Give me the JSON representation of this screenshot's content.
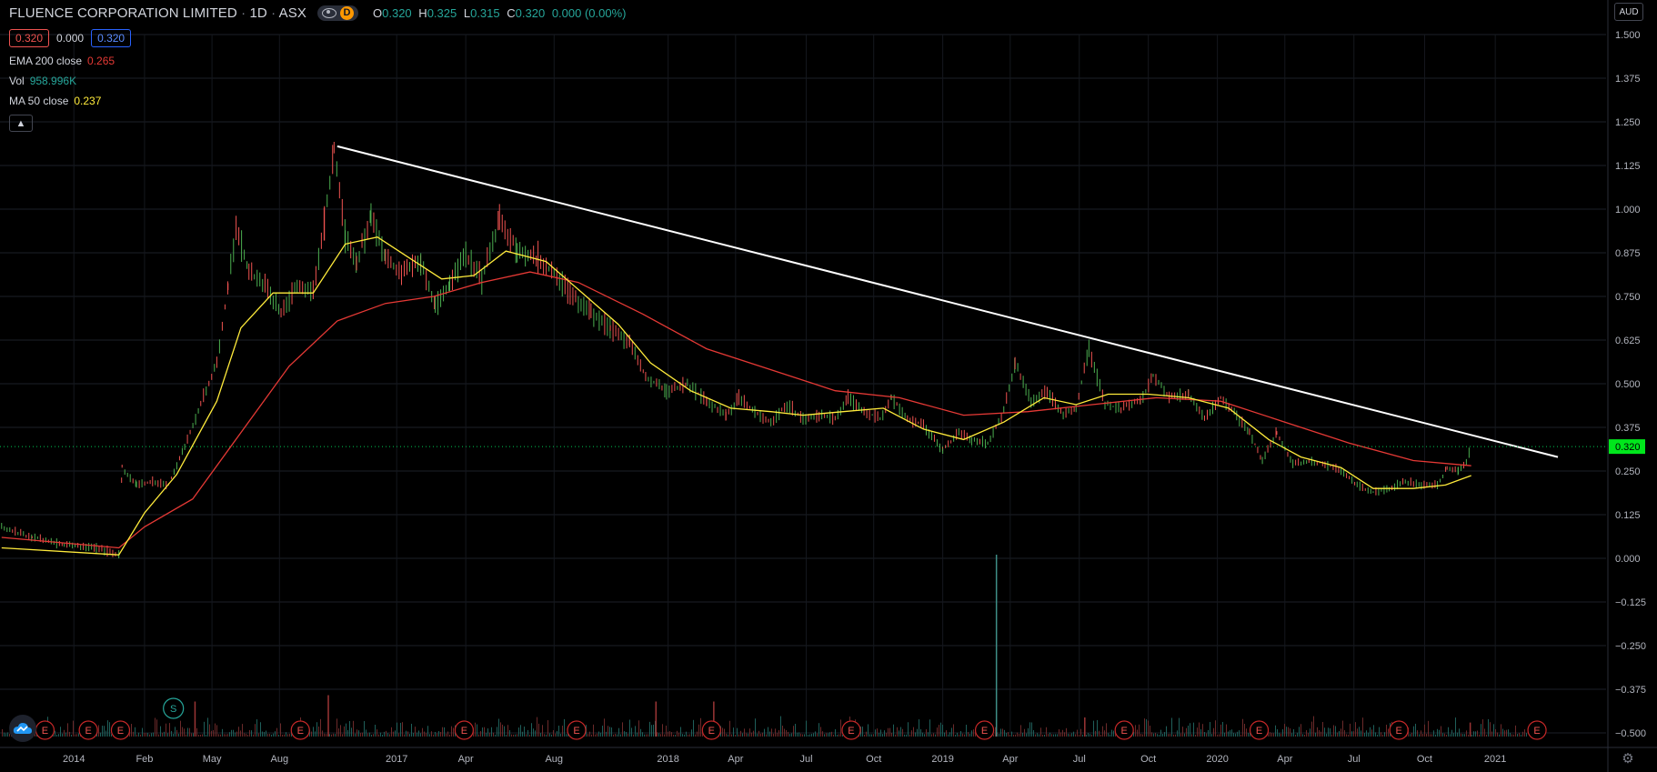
{
  "header": {
    "symbol_name": "FLUENCE CORPORATION LIMITED",
    "interval": "1D",
    "exchange": "ASX",
    "interval_badge": "D",
    "ohlc": [
      {
        "key": "O",
        "value": "0.320"
      },
      {
        "key": "H",
        "value": "0.325"
      },
      {
        "key": "L",
        "value": "0.315"
      },
      {
        "key": "C",
        "value": "0.320"
      },
      {
        "key": "",
        "value": "0.000 (0.00%)"
      }
    ]
  },
  "price_boxes": {
    "bid": "0.320",
    "spread": "0.000",
    "ask": "0.320"
  },
  "indicators": {
    "ema": {
      "label": "EMA 200 close",
      "value": "0.265"
    },
    "vol": {
      "label": "Vol",
      "value": "958.996K"
    },
    "ma": {
      "label": "MA 50 close",
      "value": "0.237"
    }
  },
  "currency": "AUD",
  "colors": {
    "background": "#000000",
    "up": "#26a69a",
    "down": "#ef5350",
    "candle_up": "#4caf50",
    "ema": "#e53935",
    "ma": "#ffeb3b",
    "trendline": "#ffffff",
    "last_price_bg": "#00e61c",
    "grid": "#2a2e39",
    "axis_text": "#b2b5be"
  },
  "icons": {
    "visibility": "eye-icon",
    "collapse": "chevron-up-icon",
    "settings": "gear-icon",
    "logo": "tradingview-cloud-icon"
  },
  "chart_data": {
    "type": "candlestick",
    "title": "FLUENCE CORPORATION LIMITED · 1D · ASX",
    "last_price": 0.32,
    "last_price_label": "0.320",
    "y_range": [
      -0.55,
      1.52
    ],
    "y_ticks": [
      1.5,
      1.375,
      1.25,
      1.125,
      1.0,
      0.875,
      0.75,
      0.625,
      0.5,
      0.375,
      0.25,
      0.125,
      0.0,
      -0.125,
      -0.25,
      -0.375,
      -0.5
    ],
    "y_tick_labels": [
      "1.500",
      "1.375",
      "1.250",
      "1.125",
      "1.000",
      "0.875",
      "0.750",
      "0.625",
      "0.500",
      "0.375",
      "0.250",
      "0.125",
      "0.000",
      "−0.125",
      "−0.250",
      "−0.375",
      "−0.500"
    ],
    "x_range": [
      "2013-09-20",
      "2021-03-28"
    ],
    "x_ticks": [
      {
        "date": "2014-01-01",
        "label": "2014"
      },
      {
        "date": "2014-02-01",
        "label": "Feb"
      },
      {
        "date": "2014-05-01",
        "label": "May"
      },
      {
        "date": "2014-08-01",
        "label": "Aug"
      },
      {
        "date": "2017-01-01",
        "label": "2017"
      },
      {
        "date": "2017-04-01",
        "label": "Apr"
      },
      {
        "date": "2017-08-01",
        "label": "Aug"
      },
      {
        "date": "2018-01-01",
        "label": "2018"
      },
      {
        "date": "2018-04-01",
        "label": "Apr"
      },
      {
        "date": "2018-07-01",
        "label": "Jul"
      },
      {
        "date": "2018-10-01",
        "label": "Oct"
      },
      {
        "date": "2019-01-01",
        "label": "2019"
      },
      {
        "date": "2019-04-01",
        "label": "Apr"
      },
      {
        "date": "2019-07-01",
        "label": "Jul"
      },
      {
        "date": "2019-10-01",
        "label": "Oct"
      },
      {
        "date": "2020-01-01",
        "label": "2020"
      },
      {
        "date": "2020-04-01",
        "label": "Apr"
      },
      {
        "date": "2020-07-01",
        "label": "Jul"
      },
      {
        "date": "2020-10-01",
        "label": "Oct"
      },
      {
        "date": "2021-01-01",
        "label": "2021"
      }
    ],
    "x_tick_screen_fraction": [
      0.046,
      0.09,
      0.132,
      0.174,
      0.247,
      0.29,
      0.345,
      0.416,
      0.458,
      0.502,
      0.544,
      0.587,
      0.629,
      0.672,
      0.715,
      0.758,
      0.8,
      0.843,
      0.887,
      0.931
    ],
    "price_points": [
      {
        "x": 0.001,
        "close": 0.09
      },
      {
        "x": 0.02,
        "close": 0.06
      },
      {
        "x": 0.04,
        "close": 0.04
      },
      {
        "x": 0.06,
        "close": 0.03
      },
      {
        "x": 0.074,
        "close": 0.01
      },
      {
        "x": 0.076,
        "close": 0.26
      },
      {
        "x": 0.085,
        "close": 0.21
      },
      {
        "x": 0.095,
        "close": 0.22
      },
      {
        "x": 0.105,
        "close": 0.21
      },
      {
        "x": 0.115,
        "close": 0.32
      },
      {
        "x": 0.125,
        "close": 0.44
      },
      {
        "x": 0.135,
        "close": 0.56
      },
      {
        "x": 0.142,
        "close": 0.78
      },
      {
        "x": 0.147,
        "close": 0.95
      },
      {
        "x": 0.155,
        "close": 0.82
      },
      {
        "x": 0.165,
        "close": 0.78
      },
      {
        "x": 0.175,
        "close": 0.7
      },
      {
        "x": 0.185,
        "close": 0.78
      },
      {
        "x": 0.195,
        "close": 0.76
      },
      {
        "x": 0.202,
        "close": 0.96
      },
      {
        "x": 0.208,
        "close": 1.17
      },
      {
        "x": 0.215,
        "close": 0.92
      },
      {
        "x": 0.222,
        "close": 0.85
      },
      {
        "x": 0.231,
        "close": 0.98
      },
      {
        "x": 0.24,
        "close": 0.86
      },
      {
        "x": 0.25,
        "close": 0.82
      },
      {
        "x": 0.262,
        "close": 0.85
      },
      {
        "x": 0.271,
        "close": 0.72
      },
      {
        "x": 0.28,
        "close": 0.79
      },
      {
        "x": 0.29,
        "close": 0.87
      },
      {
        "x": 0.3,
        "close": 0.8
      },
      {
        "x": 0.311,
        "close": 0.97
      },
      {
        "x": 0.322,
        "close": 0.88
      },
      {
        "x": 0.335,
        "close": 0.86
      },
      {
        "x": 0.345,
        "close": 0.82
      },
      {
        "x": 0.355,
        "close": 0.76
      },
      {
        "x": 0.368,
        "close": 0.7
      },
      {
        "x": 0.38,
        "close": 0.66
      },
      {
        "x": 0.392,
        "close": 0.62
      },
      {
        "x": 0.402,
        "close": 0.52
      },
      {
        "x": 0.415,
        "close": 0.48
      },
      {
        "x": 0.428,
        "close": 0.5
      },
      {
        "x": 0.44,
        "close": 0.45
      },
      {
        "x": 0.452,
        "close": 0.41
      },
      {
        "x": 0.46,
        "close": 0.46
      },
      {
        "x": 0.47,
        "close": 0.42
      },
      {
        "x": 0.48,
        "close": 0.39
      },
      {
        "x": 0.49,
        "close": 0.44
      },
      {
        "x": 0.5,
        "close": 0.4
      },
      {
        "x": 0.51,
        "close": 0.41
      },
      {
        "x": 0.52,
        "close": 0.4
      },
      {
        "x": 0.528,
        "close": 0.46
      },
      {
        "x": 0.538,
        "close": 0.42
      },
      {
        "x": 0.548,
        "close": 0.4
      },
      {
        "x": 0.555,
        "close": 0.46
      },
      {
        "x": 0.565,
        "close": 0.4
      },
      {
        "x": 0.575,
        "close": 0.38
      },
      {
        "x": 0.587,
        "close": 0.31
      },
      {
        "x": 0.597,
        "close": 0.36
      },
      {
        "x": 0.605,
        "close": 0.34
      },
      {
        "x": 0.615,
        "close": 0.33
      },
      {
        "x": 0.625,
        "close": 0.42
      },
      {
        "x": 0.632,
        "close": 0.56
      },
      {
        "x": 0.642,
        "close": 0.45
      },
      {
        "x": 0.652,
        "close": 0.48
      },
      {
        "x": 0.662,
        "close": 0.41
      },
      {
        "x": 0.67,
        "close": 0.43
      },
      {
        "x": 0.678,
        "close": 0.6
      },
      {
        "x": 0.688,
        "close": 0.44
      },
      {
        "x": 0.698,
        "close": 0.43
      },
      {
        "x": 0.71,
        "close": 0.45
      },
      {
        "x": 0.718,
        "close": 0.52
      },
      {
        "x": 0.728,
        "close": 0.46
      },
      {
        "x": 0.74,
        "close": 0.47
      },
      {
        "x": 0.75,
        "close": 0.4
      },
      {
        "x": 0.76,
        "close": 0.46
      },
      {
        "x": 0.77,
        "close": 0.41
      },
      {
        "x": 0.778,
        "close": 0.36
      },
      {
        "x": 0.786,
        "close": 0.28
      },
      {
        "x": 0.795,
        "close": 0.36
      },
      {
        "x": 0.805,
        "close": 0.27
      },
      {
        "x": 0.815,
        "close": 0.28
      },
      {
        "x": 0.825,
        "close": 0.27
      },
      {
        "x": 0.835,
        "close": 0.25
      },
      {
        "x": 0.845,
        "close": 0.21
      },
      {
        "x": 0.855,
        "close": 0.19
      },
      {
        "x": 0.865,
        "close": 0.2
      },
      {
        "x": 0.875,
        "close": 0.22
      },
      {
        "x": 0.885,
        "close": 0.21
      },
      {
        "x": 0.895,
        "close": 0.21
      },
      {
        "x": 0.901,
        "close": 0.26
      },
      {
        "x": 0.908,
        "close": 0.25
      },
      {
        "x": 0.913,
        "close": 0.28
      },
      {
        "x": 0.916,
        "close": 0.32
      }
    ],
    "ema200": [
      {
        "x": 0.001,
        "v": 0.06
      },
      {
        "x": 0.074,
        "v": 0.03
      },
      {
        "x": 0.09,
        "v": 0.09
      },
      {
        "x": 0.12,
        "v": 0.17
      },
      {
        "x": 0.15,
        "v": 0.36
      },
      {
        "x": 0.18,
        "v": 0.55
      },
      {
        "x": 0.21,
        "v": 0.68
      },
      {
        "x": 0.24,
        "v": 0.73
      },
      {
        "x": 0.27,
        "v": 0.75
      },
      {
        "x": 0.3,
        "v": 0.79
      },
      {
        "x": 0.33,
        "v": 0.82
      },
      {
        "x": 0.36,
        "v": 0.79
      },
      {
        "x": 0.4,
        "v": 0.7
      },
      {
        "x": 0.44,
        "v": 0.6
      },
      {
        "x": 0.48,
        "v": 0.54
      },
      {
        "x": 0.52,
        "v": 0.48
      },
      {
        "x": 0.56,
        "v": 0.46
      },
      {
        "x": 0.6,
        "v": 0.41
      },
      {
        "x": 0.64,
        "v": 0.42
      },
      {
        "x": 0.68,
        "v": 0.44
      },
      {
        "x": 0.72,
        "v": 0.46
      },
      {
        "x": 0.76,
        "v": 0.45
      },
      {
        "x": 0.8,
        "v": 0.39
      },
      {
        "x": 0.84,
        "v": 0.33
      },
      {
        "x": 0.88,
        "v": 0.28
      },
      {
        "x": 0.916,
        "v": 0.265
      }
    ],
    "ma50": [
      {
        "x": 0.001,
        "v": 0.03
      },
      {
        "x": 0.074,
        "v": 0.01
      },
      {
        "x": 0.09,
        "v": 0.13
      },
      {
        "x": 0.11,
        "v": 0.24
      },
      {
        "x": 0.135,
        "v": 0.45
      },
      {
        "x": 0.15,
        "v": 0.66
      },
      {
        "x": 0.17,
        "v": 0.76
      },
      {
        "x": 0.195,
        "v": 0.76
      },
      {
        "x": 0.215,
        "v": 0.9
      },
      {
        "x": 0.235,
        "v": 0.92
      },
      {
        "x": 0.255,
        "v": 0.86
      },
      {
        "x": 0.275,
        "v": 0.8
      },
      {
        "x": 0.295,
        "v": 0.81
      },
      {
        "x": 0.315,
        "v": 0.88
      },
      {
        "x": 0.34,
        "v": 0.85
      },
      {
        "x": 0.36,
        "v": 0.77
      },
      {
        "x": 0.385,
        "v": 0.67
      },
      {
        "x": 0.405,
        "v": 0.56
      },
      {
        "x": 0.43,
        "v": 0.48
      },
      {
        "x": 0.455,
        "v": 0.43
      },
      {
        "x": 0.48,
        "v": 0.42
      },
      {
        "x": 0.5,
        "v": 0.41
      },
      {
        "x": 0.525,
        "v": 0.42
      },
      {
        "x": 0.55,
        "v": 0.43
      },
      {
        "x": 0.575,
        "v": 0.37
      },
      {
        "x": 0.6,
        "v": 0.34
      },
      {
        "x": 0.625,
        "v": 0.39
      },
      {
        "x": 0.65,
        "v": 0.46
      },
      {
        "x": 0.67,
        "v": 0.44
      },
      {
        "x": 0.69,
        "v": 0.47
      },
      {
        "x": 0.715,
        "v": 0.47
      },
      {
        "x": 0.74,
        "v": 0.46
      },
      {
        "x": 0.765,
        "v": 0.43
      },
      {
        "x": 0.79,
        "v": 0.34
      },
      {
        "x": 0.81,
        "v": 0.29
      },
      {
        "x": 0.835,
        "v": 0.26
      },
      {
        "x": 0.855,
        "v": 0.2
      },
      {
        "x": 0.88,
        "v": 0.2
      },
      {
        "x": 0.9,
        "v": 0.21
      },
      {
        "x": 0.916,
        "v": 0.237
      }
    ],
    "trendline": {
      "x1": 0.21,
      "v1": 1.18,
      "x2": 0.97,
      "v2": 0.29
    },
    "volume_spikes": [
      {
        "x": 0.204,
        "h": 0.65
      },
      {
        "x": 0.121,
        "h": 0.55
      },
      {
        "x": 0.408,
        "h": 0.55
      },
      {
        "x": 0.444,
        "h": 0.55
      },
      {
        "x": 0.62,
        "h": 1.0
      },
      {
        "x": 0.675,
        "h": 0.3
      },
      {
        "x": 0.915,
        "h": 0.22
      }
    ],
    "events": [
      {
        "x": 0.012,
        "label": "E"
      },
      {
        "x": 0.028,
        "label": "E"
      },
      {
        "x": 0.055,
        "label": "E"
      },
      {
        "x": 0.075,
        "label": "E"
      },
      {
        "x": 0.187,
        "label": "E"
      },
      {
        "x": 0.289,
        "label": "E"
      },
      {
        "x": 0.359,
        "label": "E"
      },
      {
        "x": 0.443,
        "label": "E"
      },
      {
        "x": 0.53,
        "label": "E"
      },
      {
        "x": 0.613,
        "label": "E"
      },
      {
        "x": 0.7,
        "label": "E"
      },
      {
        "x": 0.784,
        "label": "E"
      },
      {
        "x": 0.871,
        "label": "E"
      },
      {
        "x": 0.957,
        "label": "E"
      }
    ],
    "split_event": {
      "x": 0.074,
      "label": "S"
    }
  }
}
